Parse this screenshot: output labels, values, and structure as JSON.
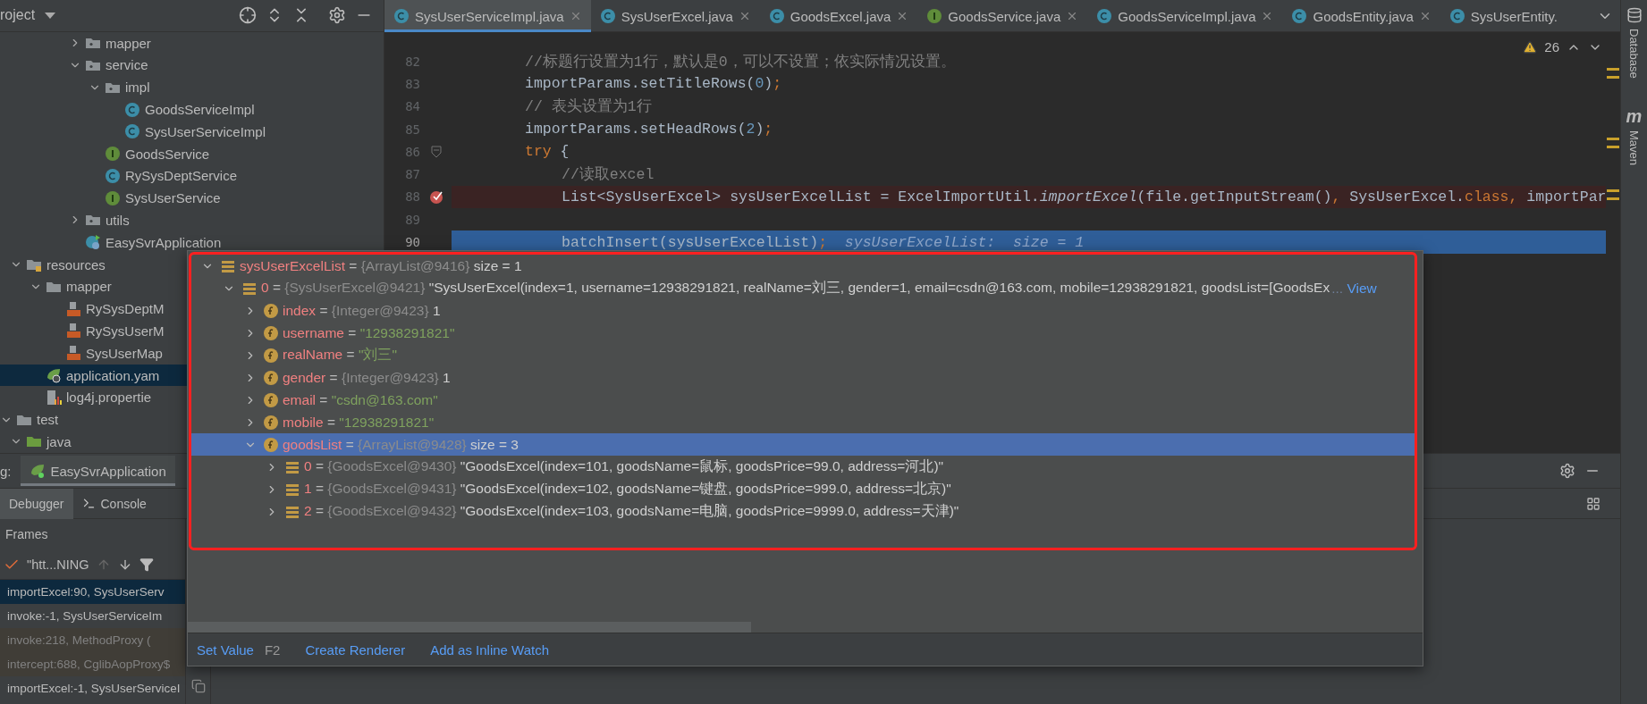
{
  "project_panel": {
    "title": "roject",
    "tree": [
      {
        "children": [
          {
            "children": [
              {
                "children": [
                  {
                    "children": [
                      {
                        "label": "mapper",
                        "kind": "folder",
                        "expanded": false,
                        "selected": false
                      },
                      {
                        "label": "service",
                        "kind": "folder",
                        "expanded": true,
                        "selected": false,
                        "children": [
                          {
                            "label": "impl",
                            "kind": "folder",
                            "expanded": true,
                            "selected": false,
                            "children": [
                              {
                                "label": "GoodsServiceImpl",
                                "kind": "class",
                                "selected": false
                              },
                              {
                                "label": "SysUserServiceImpl",
                                "kind": "class",
                                "selected": false
                              }
                            ]
                          },
                          {
                            "label": "GoodsService",
                            "kind": "interface",
                            "selected": false
                          },
                          {
                            "label": "RySysDeptService",
                            "kind": "class",
                            "selected": false
                          },
                          {
                            "label": "SysUserService",
                            "kind": "interface",
                            "selected": false
                          }
                        ]
                      },
                      {
                        "label": "utils",
                        "kind": "folder",
                        "expanded": false,
                        "selected": false
                      },
                      {
                        "label": "EasySvrApplication",
                        "kind": "app",
                        "selected": false
                      }
                    ]
                  }
                ]
              }
            ]
          },
          {
            "label": "resources",
            "kind": "resources",
            "expanded": true,
            "selected": false,
            "children": [
              {
                "label": "mapper",
                "kind": "plainfolder",
                "expanded": true,
                "selected": false,
                "children": [
                  {
                    "label": "RySysDeptM",
                    "kind": "xml",
                    "selected": false
                  },
                  {
                    "label": "RySysUserM",
                    "kind": "xml",
                    "selected": false
                  },
                  {
                    "label": "SysUserMap",
                    "kind": "xml",
                    "selected": false
                  }
                ]
              },
              {
                "label": "application.yam",
                "kind": "yaml",
                "selected": true
              },
              {
                "label": "log4j.propertie",
                "kind": "properties",
                "selected": false
              }
            ]
          }
        ]
      },
      {
        "label": "test",
        "kind": "plainfolder",
        "expanded": true,
        "selected": false,
        "children": [
          {
            "label": "java",
            "kind": "source",
            "expanded": true,
            "selected": false
          }
        ]
      }
    ]
  },
  "editor_tabs": [
    {
      "label": "SysUserServiceImpl.java",
      "kind": "class",
      "selected": true,
      "closable": true
    },
    {
      "label": "SysUserExcel.java",
      "kind": "class",
      "selected": false,
      "closable": true
    },
    {
      "label": "GoodsExcel.java",
      "kind": "class",
      "selected": false,
      "closable": true
    },
    {
      "label": "GoodsService.java",
      "kind": "interface",
      "selected": false,
      "closable": true
    },
    {
      "label": "GoodsServiceImpl.java",
      "kind": "class",
      "selected": false,
      "closable": true
    },
    {
      "label": "GoodsEntity.java",
      "kind": "class",
      "selected": false,
      "closable": true
    },
    {
      "label": "SysUserEntity.",
      "kind": "class",
      "selected": false,
      "closable": false
    }
  ],
  "editor": {
    "warnings": "26",
    "lines": [
      {
        "number": "82",
        "breakpoint": false,
        "current": false,
        "foldable": false,
        "tokens": [
          {
            "text": "//标题行设置为1行，默认是0，可以不设置；依实际情况设置。",
            "kind": "comment"
          }
        ]
      },
      {
        "number": "83",
        "breakpoint": false,
        "current": false,
        "foldable": false,
        "tokens": [
          {
            "text": "importParams.setTitleRows(",
            "kind": "plain"
          },
          {
            "text": "0",
            "kind": "number"
          },
          {
            "text": ")",
            "kind": "plain"
          },
          {
            "text": ";",
            "kind": "keyword"
          }
        ]
      },
      {
        "number": "84",
        "breakpoint": false,
        "current": false,
        "foldable": false,
        "tokens": [
          {
            "text": "// 表头设置为1行",
            "kind": "comment"
          }
        ]
      },
      {
        "number": "85",
        "breakpoint": false,
        "current": false,
        "foldable": false,
        "tokens": [
          {
            "text": "importParams.setHeadRows(",
            "kind": "plain"
          },
          {
            "text": "2",
            "kind": "number"
          },
          {
            "text": ")",
            "kind": "plain"
          },
          {
            "text": ";",
            "kind": "keyword"
          }
        ]
      },
      {
        "number": "86",
        "breakpoint": false,
        "current": false,
        "foldable": true,
        "tokens": [
          {
            "text": "try",
            "kind": "keyword"
          },
          {
            "text": " {",
            "kind": "plain"
          }
        ],
        "children": [
          {
            "number": "87",
            "breakpoint": false,
            "current": false,
            "foldable": false,
            "tokens": [
              {
                "text": "//读取excel",
                "kind": "comment"
              }
            ]
          },
          {
            "number": "88",
            "breakpoint": true,
            "current": false,
            "foldable": false,
            "tokens": [
              {
                "text": "List<SysUserExcel> sysUserExcelList = ExcelImportUtil.",
                "kind": "plain"
              },
              {
                "text": "importExcel",
                "kind": "italic"
              },
              {
                "text": "(file.getInputStream()",
                "kind": "plain"
              },
              {
                "text": ", ",
                "kind": "keyword"
              },
              {
                "text": "SysUserExcel.",
                "kind": "plain"
              },
              {
                "text": "class",
                "kind": "keyword"
              },
              {
                "text": ", ",
                "kind": "keyword"
              },
              {
                "text": "importPar",
                "kind": "plain"
              }
            ]
          },
          {
            "number": "89",
            "breakpoint": false,
            "current": false
          },
          {
            "number": "90",
            "breakpoint": false,
            "current": true,
            "foldable": false,
            "tokens": [
              {
                "text": "batchInsert(sysUserExcelList)",
                "kind": "plain"
              },
              {
                "text": ";",
                "kind": "keyword"
              },
              {
                "text": "  sysUserExcelList:  size = 1",
                "kind": "hint"
              }
            ]
          }
        ]
      }
    ]
  },
  "debug_panel": {
    "label": "g:",
    "run_tab": "EasySvrApplication",
    "tabs": [
      {
        "label": "Debugger",
        "kind": "debugger",
        "selected": true
      },
      {
        "label": "Console",
        "kind": "console",
        "selected": false
      }
    ],
    "frames_title": "Frames",
    "thread": "\"htt...NING",
    "frames": [
      {
        "label": "importExcel:90, SysUserServ",
        "selected": true,
        "dimmed": false
      },
      {
        "label": "invoke:-1, SysUserServiceIm",
        "selected": false,
        "dimmed": false
      },
      {
        "label": "invoke:218, MethodProxy (",
        "selected": false,
        "dimmed": true
      },
      {
        "label": "intercept:688, CglibAopProxy$",
        "selected": false,
        "dimmed": true
      },
      {
        "label": "importExcel:-1, SysUserServiceI",
        "selected": false,
        "dimmed": false
      }
    ]
  },
  "value_popup": {
    "nodes": [
      {
        "name": "sysUserExcelList",
        "sign": "=",
        "ref": "{ArrayList@9416}",
        "value": "size = 1",
        "is_string": false,
        "kind": "list",
        "expanded": true,
        "selected": false,
        "children": [
          {
            "name": "0",
            "sign": "=",
            "ref": "{SysUserExcel@9421}",
            "value": "\"SysUserExcel(index=1, username=12938291821, realName=刘三, gender=1, email=csdn@163.com, mobile=12938291821, goodsList=[GoodsEx",
            "is_string": false,
            "more": "...",
            "link": "View",
            "kind": "list",
            "expanded": true,
            "selected": false,
            "children": [
              {
                "name": "index",
                "sign": "=",
                "ref": "{Integer@9423}",
                "value": "1",
                "is_string": false,
                "kind": "field",
                "expanded": false,
                "selected": false
              },
              {
                "name": "username",
                "sign": "=",
                "value": "\"12938291821\"",
                "is_string": true,
                "kind": "field",
                "expanded": false,
                "selected": false
              },
              {
                "name": "realName",
                "sign": "=",
                "value": "\"刘三\"",
                "is_string": true,
                "kind": "field",
                "expanded": false,
                "selected": false
              },
              {
                "name": "gender",
                "sign": "=",
                "ref": "{Integer@9423}",
                "value": "1",
                "is_string": false,
                "kind": "field",
                "expanded": false,
                "selected": false
              },
              {
                "name": "email",
                "sign": "=",
                "value": "\"csdn@163.com\"",
                "is_string": true,
                "kind": "field",
                "expanded": false,
                "selected": false
              },
              {
                "name": "mobile",
                "sign": "=",
                "value": "\"12938291821\"",
                "is_string": true,
                "kind": "field",
                "expanded": false,
                "selected": false
              },
              {
                "name": "goodsList",
                "sign": "=",
                "ref": "{ArrayList@9428}",
                "value": "size = 3",
                "is_string": false,
                "kind": "field",
                "expanded": true,
                "selected": true,
                "children": [
                  {
                    "name": "0",
                    "sign": "=",
                    "ref": "{GoodsExcel@9430}",
                    "value": "\"GoodsExcel(index=101, goodsName=鼠标, goodsPrice=99.0, address=河北)\"",
                    "is_string": false,
                    "kind": "list",
                    "expanded": false,
                    "selected": false
                  },
                  {
                    "name": "1",
                    "sign": "=",
                    "ref": "{GoodsExcel@9431}",
                    "value": "\"GoodsExcel(index=102, goodsName=键盘, goodsPrice=999.0, address=北京)\"",
                    "is_string": false,
                    "kind": "list",
                    "expanded": false,
                    "selected": false
                  },
                  {
                    "name": "2",
                    "sign": "=",
                    "ref": "{GoodsExcel@9432}",
                    "value": "\"GoodsExcel(index=103, goodsName=电脑, goodsPrice=9999.0, address=天津)\"",
                    "is_string": false,
                    "kind": "list",
                    "expanded": false,
                    "selected": false
                  }
                ]
              }
            ]
          }
        ]
      }
    ],
    "actions": [
      {
        "label": "Set Value",
        "shortcut": "F2"
      },
      {
        "label": "Create Renderer"
      },
      {
        "label": "Add as Inline Watch"
      }
    ]
  },
  "right_stripe": [
    {
      "label": "Database",
      "kind": "database"
    },
    {
      "label": "Maven",
      "kind": "maven",
      "icon": "m"
    }
  ]
}
